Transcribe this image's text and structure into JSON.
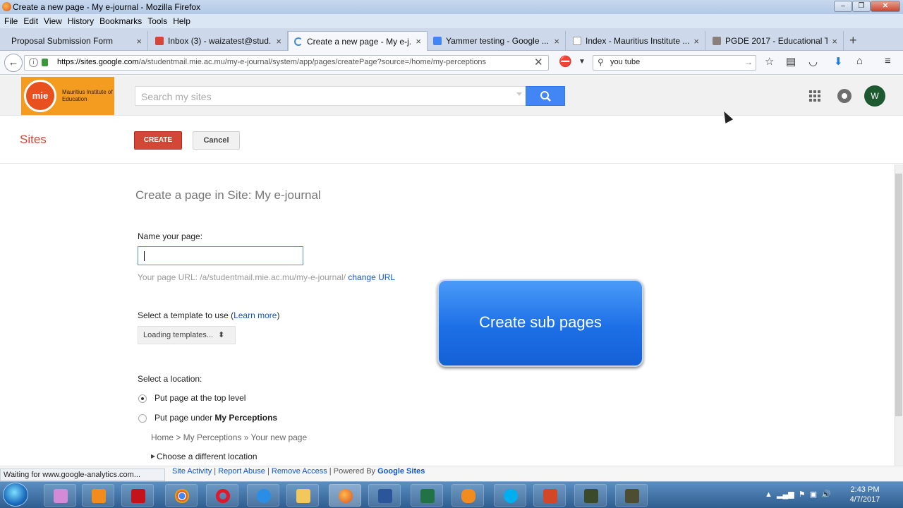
{
  "window": {
    "title": "Create a new page - My e-journal - Mozilla Firefox"
  },
  "menu": [
    "File",
    "Edit",
    "View",
    "History",
    "Bookmarks",
    "Tools",
    "Help"
  ],
  "tabs": [
    {
      "label": "Proposal Submission Form",
      "active": false
    },
    {
      "label": "Inbox (3) - waizatest@stud...",
      "active": false
    },
    {
      "label": "Create a new page - My e-j...",
      "active": true
    },
    {
      "label": "Yammer testing - Google ...",
      "active": false
    },
    {
      "label": "Index - Mauritius Institute ...",
      "active": false
    },
    {
      "label": "PGDE 2017 - Educational T...",
      "active": false
    }
  ],
  "address": {
    "url_host": "https://sites.google.com",
    "url_path": "/a/studentmail.mie.ac.mu/my-e-journal/system/app/pages/createPage?source=/home/my-perceptions"
  },
  "browser_search": {
    "value": "you tube"
  },
  "logo": {
    "abbr": "mie",
    "text": "Mauritius Institute of Education"
  },
  "site_search": {
    "placeholder": "Search my sites"
  },
  "user": {
    "initial": "W"
  },
  "sites_bar": {
    "title": "Sites",
    "create_label": "CREATE",
    "cancel_label": "Cancel"
  },
  "form": {
    "heading": "Create a page in Site: My e-journal",
    "name_label": "Name your page:",
    "url_hint": "Your page URL: /a/studentmail.mie.ac.mu/my-e-journal/",
    "change_url": "change URL",
    "template_label": "Select a template to use (",
    "learn_more": "Learn more",
    "template_close": ")",
    "template_value": "Loading templates...",
    "location_label": "Select a location:",
    "option_top": "Put page at the top level",
    "option_under_prefix": "Put page under ",
    "option_under_page": "My Perceptions",
    "breadcrumb": "Home > My Perceptions » Your new page",
    "choose_location": "Choose a different location"
  },
  "overlay": {
    "label": "Create sub pages"
  },
  "footer": {
    "site_activity": "Site Activity",
    "report_abuse": "Report Abuse",
    "remove_access": "Remove Access",
    "powered_by": "Powered By",
    "google_sites": "Google Sites"
  },
  "status": {
    "text": "Waiting for www.google-analytics.com..."
  },
  "clock": {
    "time": "2:43 PM",
    "date": "4/7/2017"
  },
  "colors": {
    "accent_red": "#d14836",
    "google_blue": "#4285f4",
    "overlay_blue": "#1d6fe6"
  }
}
